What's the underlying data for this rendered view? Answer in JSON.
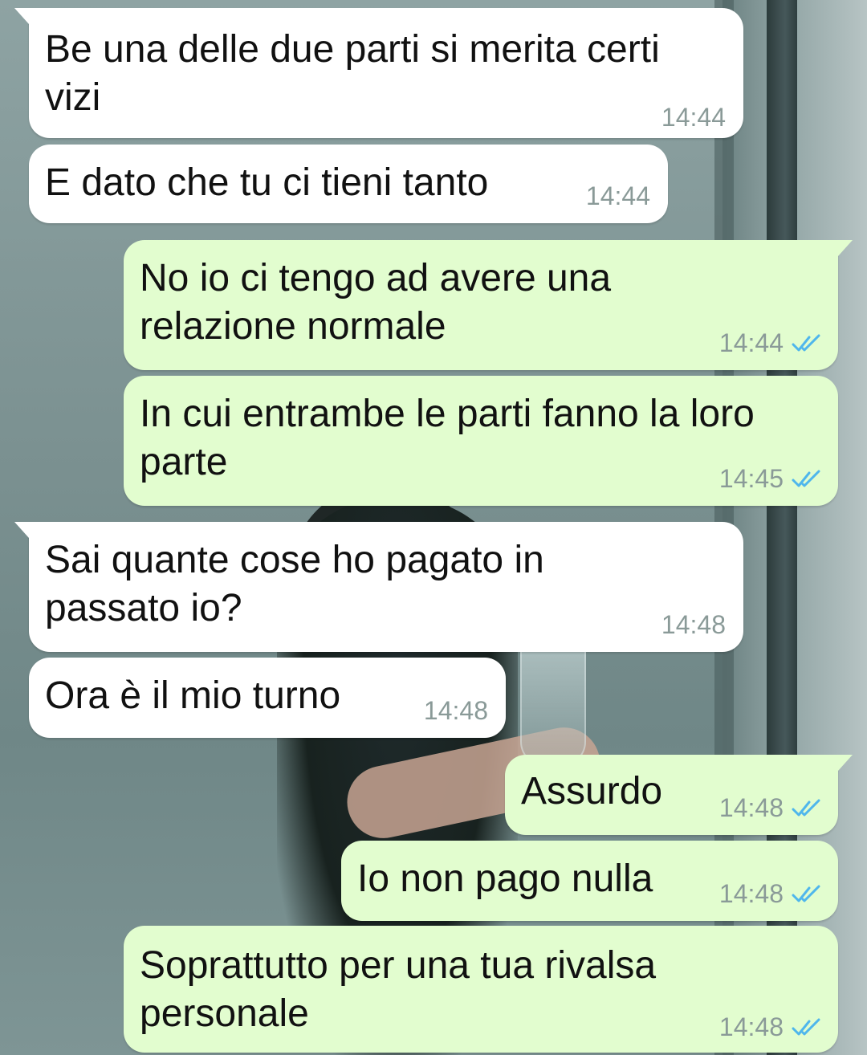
{
  "theme": {
    "incoming_bubble": "#ffffff",
    "outgoing_bubble": "#e2fdcf",
    "text_color": "#111111",
    "time_color": "#8a9a98",
    "read_tick_color": "#4fb6ec"
  },
  "messages": [
    {
      "direction": "incoming",
      "text": "Be una delle due parti si merita certi\nvizi",
      "time": "14:44"
    },
    {
      "direction": "incoming",
      "text": "E dato che tu ci tieni tanto",
      "time": "14:44"
    },
    {
      "direction": "outgoing",
      "text": "No io ci tengo ad avere una\nrelazione normale",
      "time": "14:44",
      "status": "read-double-check-icon"
    },
    {
      "direction": "outgoing",
      "text": "In cui entrambe le parti fanno la loro\nparte",
      "time": "14:45",
      "status": "read-double-check-icon"
    },
    {
      "direction": "incoming",
      "text": "Sai quante cose ho pagato in\npassato io?",
      "time": "14:48"
    },
    {
      "direction": "incoming",
      "text": "Ora è il mio turno",
      "time": "14:48"
    },
    {
      "direction": "outgoing",
      "text": "Assurdo",
      "time": "14:48",
      "status": "read-double-check-icon"
    },
    {
      "direction": "outgoing",
      "text": "Io non pago nulla",
      "time": "14:48",
      "status": "read-double-check-icon"
    },
    {
      "direction": "outgoing",
      "text": "Soprattutto per una tua rivalsa\npersonale",
      "time": "14:48",
      "status": "read-double-check-icon"
    }
  ]
}
